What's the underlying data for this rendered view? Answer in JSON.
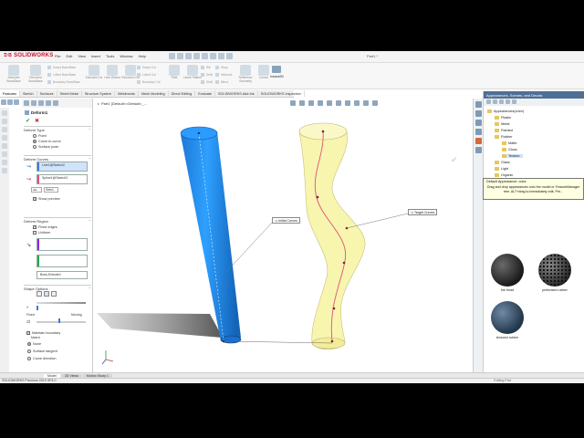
{
  "app": {
    "brand": "SOLIDWORKS",
    "document_title": "Part1 *",
    "menu": [
      "File",
      "Edit",
      "View",
      "Insert",
      "Tools",
      "Window",
      "Help"
    ]
  },
  "ribbon": {
    "groups": [
      "Extruded Boss/Base",
      "Revolved Boss/Base",
      "Swept Boss/Base",
      "Lofted Boss/Base",
      "Boundary Boss/Base",
      "Extruded Cut",
      "Hole Wizard",
      "Revolved Cut",
      "Swept Cut",
      "Lofted Cut",
      "Boundary Cut",
      "Fillet",
      "Linear Pattern",
      "Rib",
      "Draft",
      "Shell",
      "Wrap",
      "Intersect",
      "Mirror",
      "Reference Geometry",
      "Curves"
    ],
    "instant3d": "Instant3D"
  },
  "command_tabs": {
    "items": [
      "Features",
      "Sketch",
      "Surfaces",
      "Sheet Metal",
      "Structure System",
      "Weldments",
      "Mesh Modeling",
      "Direct Editing",
      "Evaluate",
      "SOLIDWORKS Add-Ins",
      "SOLIDWORKS Inspection"
    ],
    "active": 0
  },
  "graphics": {
    "breadcrumb": "Part1 (Default<<Default>_...",
    "callout_initial": "Initial Curves",
    "callout_target": "Target Curves"
  },
  "property_manager": {
    "title": "Deform1",
    "deform_type": {
      "heading": "Deform Type",
      "options": [
        "Point",
        "Curve to curve",
        "Surface push"
      ],
      "selected": 1
    },
    "deform_curves": {
      "heading": "Deform Curves",
      "initial_value": "Line1@Sketch2",
      "target_value": "Spline1@Sketch3",
      "spin_value": "Sets1",
      "show_preview": "Show preview"
    },
    "deform_regions": {
      "heading": "Deform Region",
      "fixed_edges": "Fixed edges",
      "uniform": "Uniform",
      "body_value": "Boss-Extrude1"
    },
    "shape_options": {
      "heading": "Shape Options",
      "fixed_label": "Fixed",
      "moving_label": "Moving",
      "maintain_boundary": "Maintain boundary",
      "match_label": "Match",
      "match_options": [
        "None",
        "Surface tangent",
        "Curve direction"
      ],
      "match_selected": 0
    }
  },
  "task_pane": {
    "header": "Appearances, Scenes, and Decals",
    "tree": [
      {
        "label": "Appearances(color)",
        "indent": 0
      },
      {
        "label": "Plastic",
        "indent": 1
      },
      {
        "label": "Metal",
        "indent": 1
      },
      {
        "label": "Painted",
        "indent": 1
      },
      {
        "label": "Rubber",
        "indent": 1
      },
      {
        "label": "Matte",
        "indent": 2
      },
      {
        "label": "Gloss",
        "indent": 2
      },
      {
        "label": "Texture",
        "indent": 2
      },
      {
        "label": "Glass",
        "indent": 1
      },
      {
        "label": "Light",
        "indent": 1
      },
      {
        "label": "Organic",
        "indent": 1
      }
    ],
    "selected_index": 7,
    "tooltip": {
      "title": "Default Appearance: color",
      "body": "Drag and drop appearances onto the model or FeatureManager tree. ALT+drag to immediately edit. Pre..."
    },
    "swatches": [
      {
        "label": "tire tread",
        "color": "#2c2c2c"
      },
      {
        "label": "perforated rubber",
        "color": "#3a3a3a"
      },
      {
        "label": "textured rubber",
        "color": "#33495f"
      }
    ]
  },
  "bottom_tabs": {
    "items": [
      "Model",
      "3D Views",
      "Motion Study 1"
    ],
    "active": 0
  },
  "status": {
    "left": "SOLIDWORKS Premium 2019 SP4.0",
    "right": "Editing Part"
  },
  "colors": {
    "cylinder": "#1e90ff",
    "deformed": "#f7f3a0",
    "target_curve": "#d9557a",
    "accent": "#2f6fb3"
  }
}
